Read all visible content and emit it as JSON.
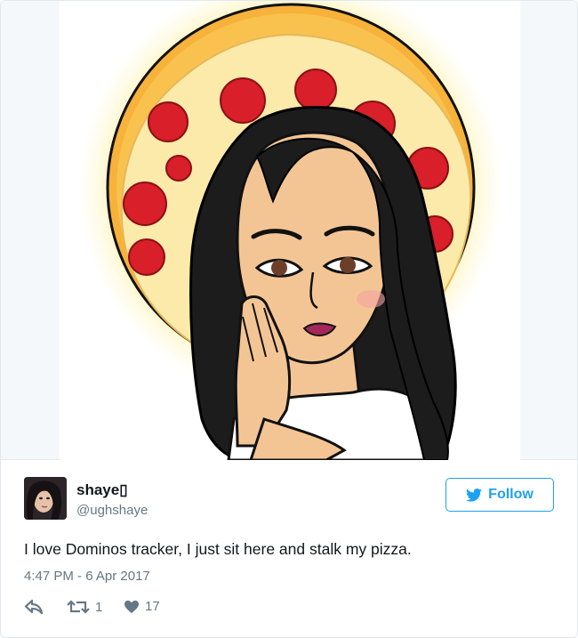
{
  "tweet": {
    "display_name": "shaye▯",
    "handle": "@ughshaye",
    "follow_label": "Follow",
    "text": "I love Dominos tracker, I just sit here and stalk my pizza.",
    "timestamp": "4:47 PM - 6 Apr 2017",
    "retweet_count": "1",
    "like_count": "17"
  },
  "colors": {
    "accent": "#1da1f2",
    "secondary_text": "#657786",
    "border": "#e1e8ed"
  },
  "icons": {
    "reply": "reply-icon",
    "retweet": "retweet-icon",
    "like": "heart-icon",
    "follow": "twitter-bird-icon"
  }
}
